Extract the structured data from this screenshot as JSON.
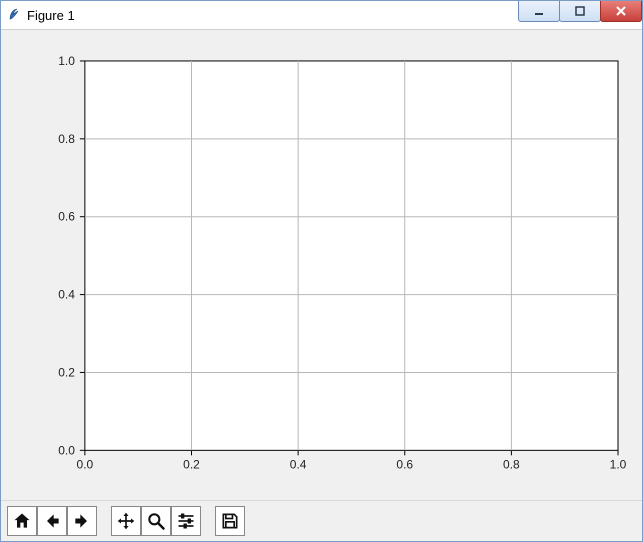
{
  "window": {
    "title": "Figure 1",
    "controls": {
      "minimize_tooltip": "Minimize",
      "maximize_tooltip": "Maximize",
      "close_tooltip": "Close"
    }
  },
  "toolbar": {
    "home_tooltip": "Reset original view",
    "back_tooltip": "Back to previous view",
    "forward_tooltip": "Forward to next view",
    "pan_tooltip": "Pan axes",
    "zoom_tooltip": "Zoom to rectangle",
    "configure_tooltip": "Configure subplots",
    "save_tooltip": "Save the figure"
  },
  "chart_data": {
    "type": "line",
    "series": [],
    "x": [],
    "title": "",
    "xlabel": "",
    "ylabel": "",
    "xlim": [
      0.0,
      1.0
    ],
    "ylim": [
      0.0,
      1.0
    ],
    "xticks": [
      0.0,
      0.2,
      0.4,
      0.6,
      0.8,
      1.0
    ],
    "yticks": [
      0.0,
      0.2,
      0.4,
      0.6,
      0.8,
      1.0
    ],
    "xtick_labels": [
      "0.0",
      "0.2",
      "0.4",
      "0.6",
      "0.8",
      "1.0"
    ],
    "ytick_labels": [
      "0.0",
      "0.2",
      "0.4",
      "0.6",
      "0.8",
      "1.0"
    ],
    "grid": true
  }
}
